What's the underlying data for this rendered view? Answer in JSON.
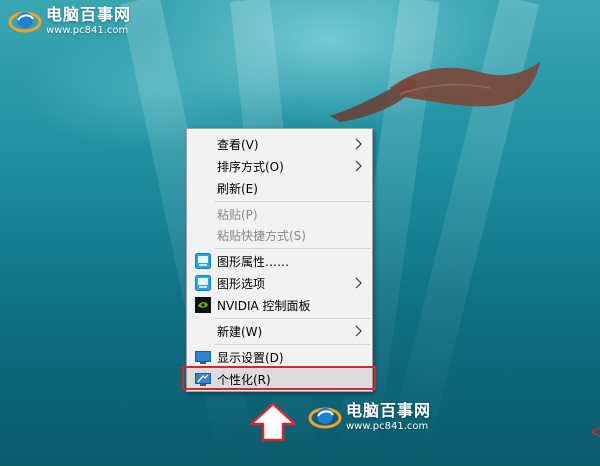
{
  "watermark": {
    "title": "电脑百事网",
    "url": "www.pc841.com"
  },
  "context_menu": {
    "items": [
      {
        "label": "查看(V)",
        "has_submenu": true,
        "enabled": true
      },
      {
        "label": "排序方式(O)",
        "has_submenu": true,
        "enabled": true
      },
      {
        "label": "刷新(E)",
        "has_submenu": false,
        "enabled": true
      },
      {
        "label": "粘贴(P)",
        "has_submenu": false,
        "enabled": false
      },
      {
        "label": "粘贴快捷方式(S)",
        "has_submenu": false,
        "enabled": false
      },
      {
        "label": "图形属性……",
        "icon": "intel-graphics-icon",
        "has_submenu": false,
        "enabled": true
      },
      {
        "label": "图形选项",
        "icon": "intel-graphics-icon",
        "has_submenu": true,
        "enabled": true
      },
      {
        "label": "NVIDIA 控制面板",
        "icon": "nvidia-icon",
        "has_submenu": false,
        "enabled": true
      },
      {
        "label": "新建(W)",
        "has_submenu": true,
        "enabled": true
      },
      {
        "label": "显示设置(D)",
        "icon": "display-settings-icon",
        "has_submenu": false,
        "enabled": true
      },
      {
        "label": "个性化(R)",
        "icon": "personalize-icon",
        "has_submenu": false,
        "enabled": true,
        "highlighted": true
      }
    ]
  },
  "colors": {
    "highlight_box": "#d9262c",
    "menu_background": "#f2f2f2"
  }
}
